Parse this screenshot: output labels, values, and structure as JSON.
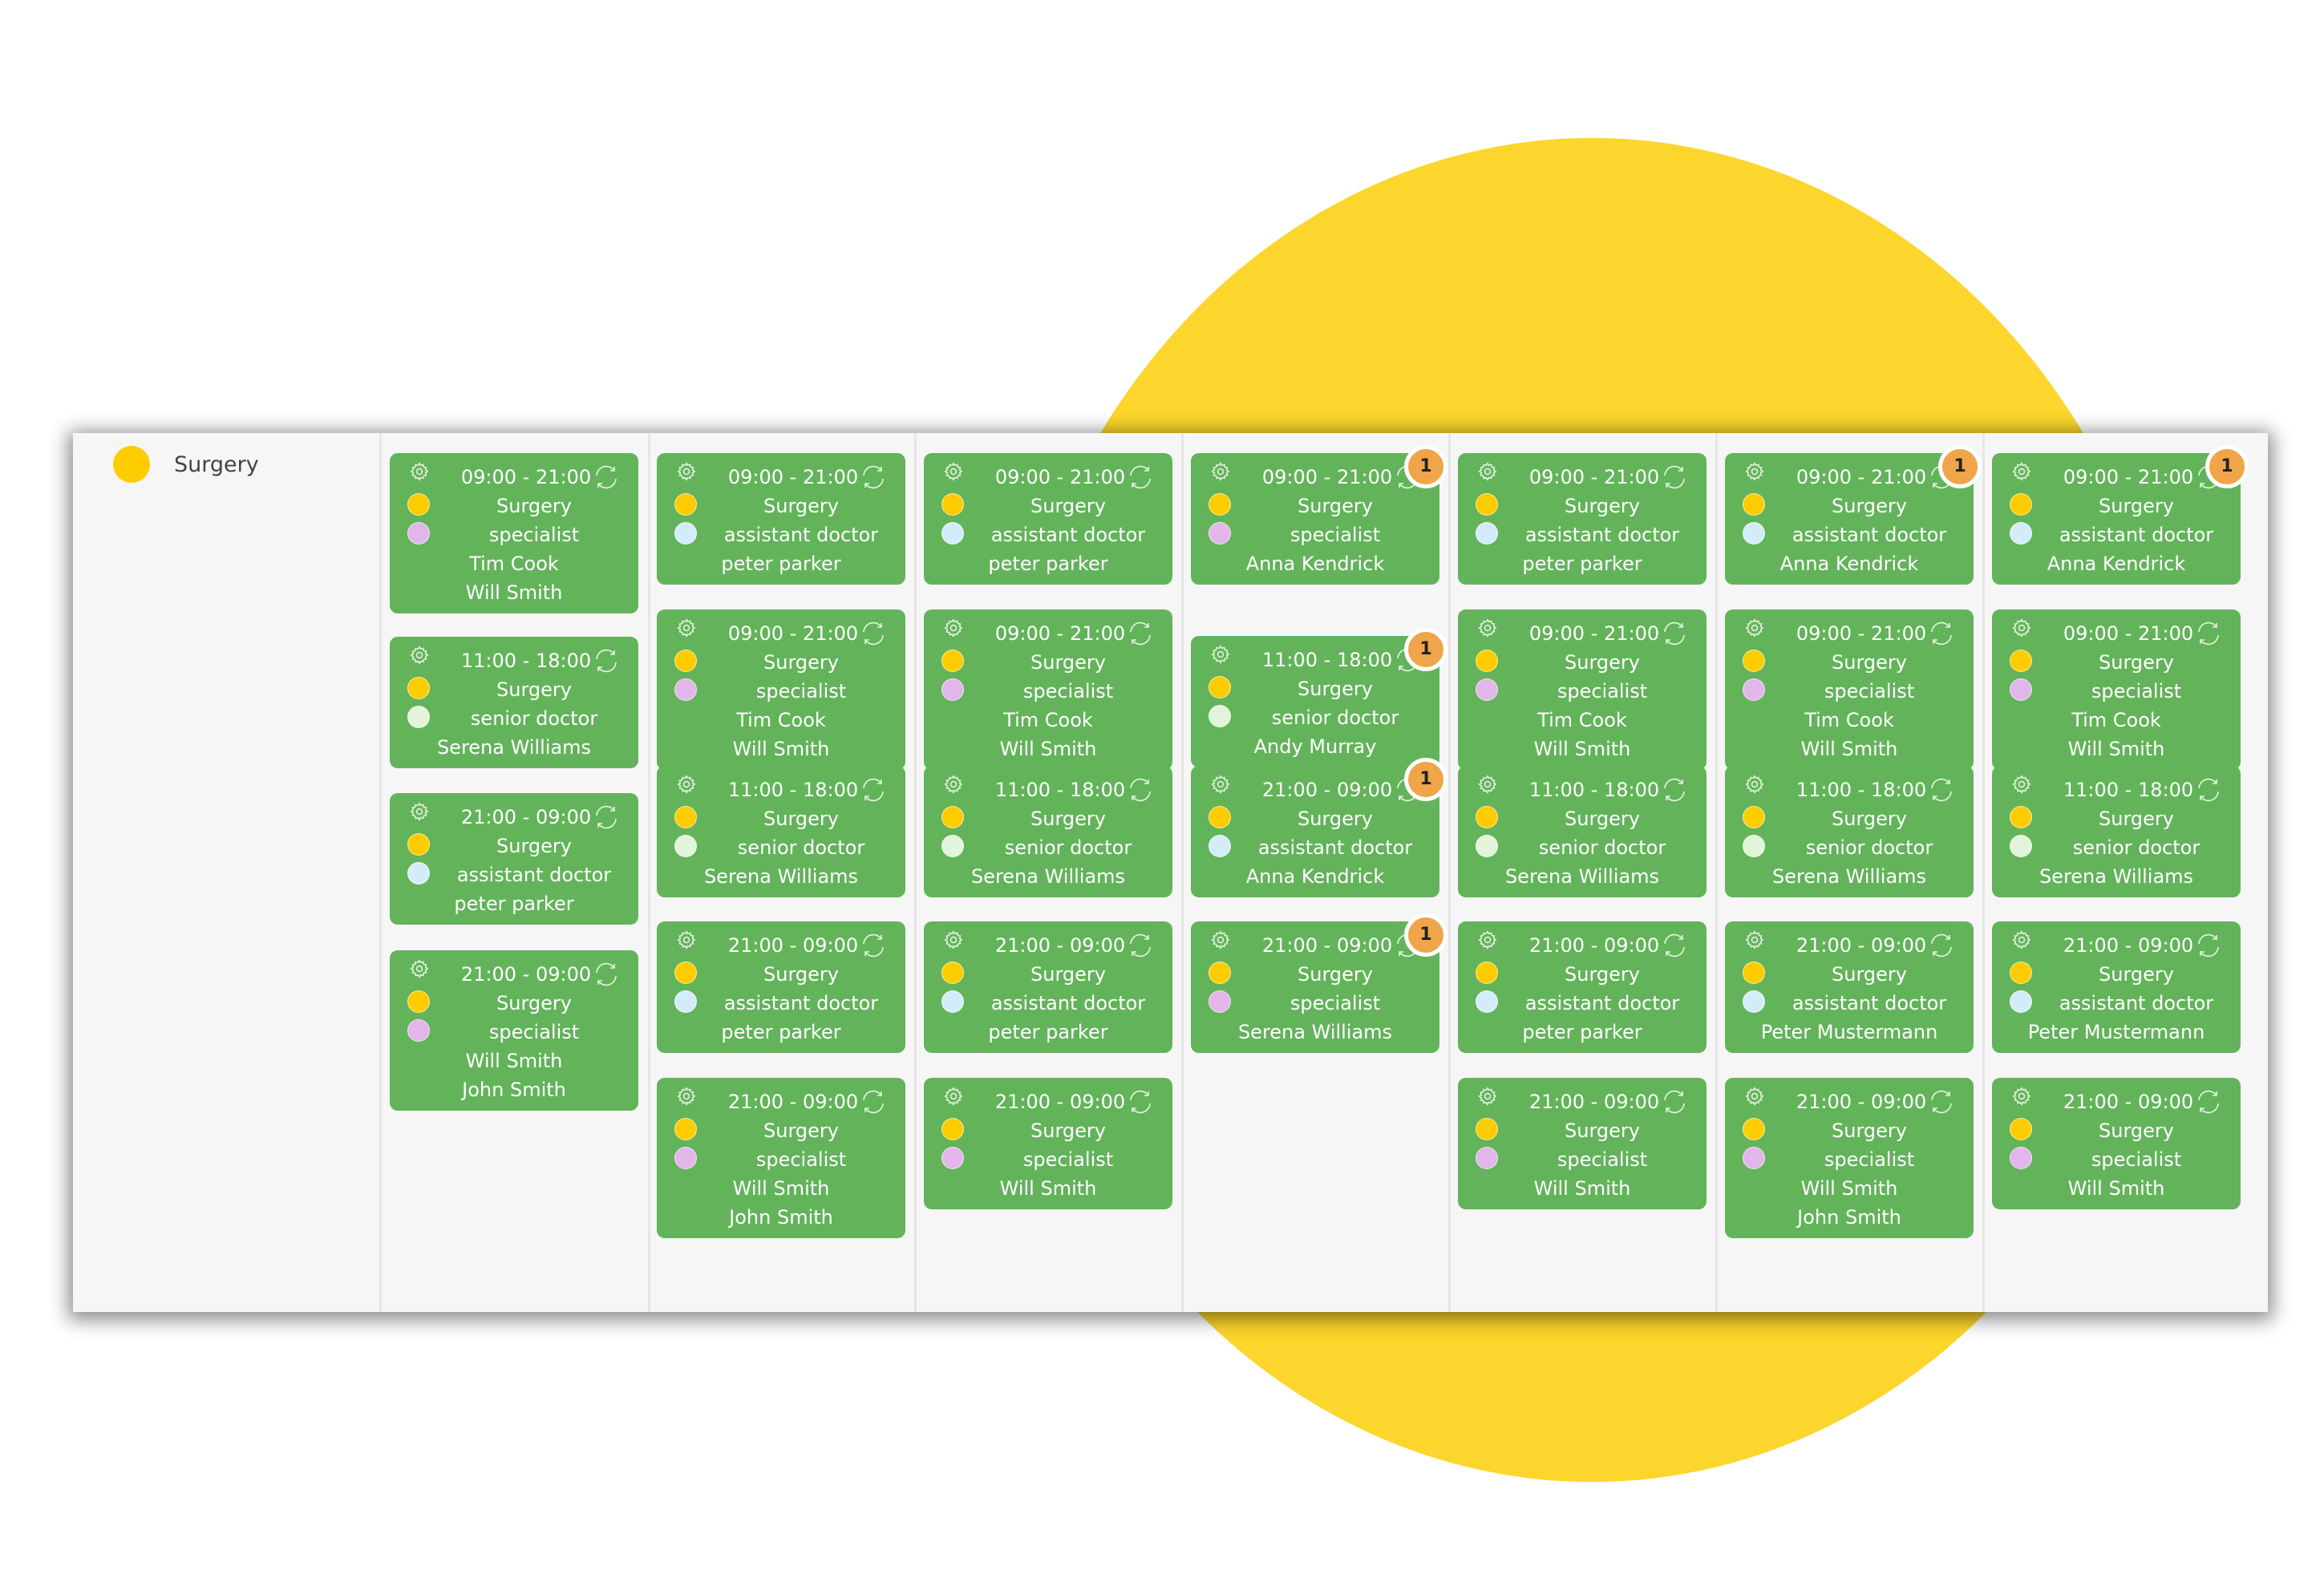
{
  "colors": {
    "card_bg": "#63b35b",
    "surgery_dot": "#ffcc00",
    "specialist_dot": "#e2b6ea",
    "assistant_dot": "#d4ecfa",
    "senior_dot": "#e2f5da",
    "badge": "#f0a54a",
    "accent_blob": "#fcd62c"
  },
  "legend": {
    "label": "Surgery",
    "color": "#ffcc00"
  },
  "columns": [
    {
      "cards": [
        {
          "time": "09:00 - 21:00",
          "dept": "Surgery",
          "role": "specialist",
          "people": [
            "Tim Cook",
            "Will Smith"
          ],
          "badge": null
        },
        {
          "time": "11:00 - 18:00",
          "dept": "Surgery",
          "role": "senior doctor",
          "people": [
            "Serena Williams"
          ],
          "badge": null
        },
        {
          "time": "21:00 - 09:00",
          "dept": "Surgery",
          "role": "assistant doctor",
          "people": [
            "peter parker"
          ],
          "badge": null
        },
        {
          "time": "21:00 - 09:00",
          "dept": "Surgery",
          "role": "specialist",
          "people": [
            "Will Smith",
            "John Smith"
          ],
          "badge": null
        }
      ]
    },
    {
      "cards": [
        {
          "time": "09:00 - 21:00",
          "dept": "Surgery",
          "role": "assistant doctor",
          "people": [
            "peter parker"
          ],
          "badge": null
        },
        {
          "time": "09:00 - 21:00",
          "dept": "Surgery",
          "role": "specialist",
          "people": [
            "Tim Cook",
            "Will Smith"
          ],
          "badge": null
        },
        {
          "time": "11:00 - 18:00",
          "dept": "Surgery",
          "role": "senior doctor",
          "people": [
            "Serena Williams"
          ],
          "badge": null
        },
        {
          "time": "21:00 - 09:00",
          "dept": "Surgery",
          "role": "assistant doctor",
          "people": [
            "peter parker"
          ],
          "badge": null
        },
        {
          "time": "21:00 - 09:00",
          "dept": "Surgery",
          "role": "specialist",
          "people": [
            "Will Smith",
            "John Smith"
          ],
          "badge": null
        }
      ]
    },
    {
      "cards": [
        {
          "time": "09:00 - 21:00",
          "dept": "Surgery",
          "role": "assistant doctor",
          "people": [
            "peter parker"
          ],
          "badge": null
        },
        {
          "time": "09:00 - 21:00",
          "dept": "Surgery",
          "role": "specialist",
          "people": [
            "Tim Cook",
            "Will Smith"
          ],
          "badge": null
        },
        {
          "time": "11:00 - 18:00",
          "dept": "Surgery",
          "role": "senior doctor",
          "people": [
            "Serena Williams"
          ],
          "badge": null
        },
        {
          "time": "21:00 - 09:00",
          "dept": "Surgery",
          "role": "assistant doctor",
          "people": [
            "peter parker"
          ],
          "badge": null
        },
        {
          "time": "21:00 - 09:00",
          "dept": "Surgery",
          "role": "specialist",
          "people": [
            "Will Smith"
          ],
          "badge": null
        }
      ]
    },
    {
      "cards": [
        {
          "time": "09:00 - 21:00",
          "dept": "Surgery",
          "role": "specialist",
          "people": [
            "Anna Kendrick"
          ],
          "badge": "1"
        },
        {
          "time": "11:00 - 18:00",
          "dept": "Surgery",
          "role": "senior doctor",
          "people": [
            "Andy Murray"
          ],
          "badge": "1"
        },
        {
          "time": "21:00 - 09:00",
          "dept": "Surgery",
          "role": "assistant doctor",
          "people": [
            "Anna Kendrick"
          ],
          "badge": "1"
        },
        {
          "time": "21:00 - 09:00",
          "dept": "Surgery",
          "role": "specialist",
          "people": [
            "Serena Williams"
          ],
          "badge": "1"
        }
      ]
    },
    {
      "cards": [
        {
          "time": "09:00 - 21:00",
          "dept": "Surgery",
          "role": "assistant doctor",
          "people": [
            "peter parker"
          ],
          "badge": null
        },
        {
          "time": "09:00 - 21:00",
          "dept": "Surgery",
          "role": "specialist",
          "people": [
            "Tim Cook",
            "Will Smith"
          ],
          "badge": null
        },
        {
          "time": "11:00 - 18:00",
          "dept": "Surgery",
          "role": "senior doctor",
          "people": [
            "Serena Williams"
          ],
          "badge": null
        },
        {
          "time": "21:00 - 09:00",
          "dept": "Surgery",
          "role": "assistant doctor",
          "people": [
            "peter parker"
          ],
          "badge": null
        },
        {
          "time": "21:00 - 09:00",
          "dept": "Surgery",
          "role": "specialist",
          "people": [
            "Will Smith"
          ],
          "badge": null
        }
      ]
    },
    {
      "cards": [
        {
          "time": "09:00 - 21:00",
          "dept": "Surgery",
          "role": "assistant doctor",
          "people": [
            "Anna Kendrick"
          ],
          "badge": "1"
        },
        {
          "time": "09:00 - 21:00",
          "dept": "Surgery",
          "role": "specialist",
          "people": [
            "Tim Cook",
            "Will Smith"
          ],
          "badge": null
        },
        {
          "time": "11:00 - 18:00",
          "dept": "Surgery",
          "role": "senior doctor",
          "people": [
            "Serena Williams"
          ],
          "badge": null
        },
        {
          "time": "21:00 - 09:00",
          "dept": "Surgery",
          "role": "assistant doctor",
          "people": [
            "Peter Mustermann"
          ],
          "badge": null
        },
        {
          "time": "21:00 - 09:00",
          "dept": "Surgery",
          "role": "specialist",
          "people": [
            "Will Smith",
            "John Smith"
          ],
          "badge": null
        }
      ]
    },
    {
      "cards": [
        {
          "time": "09:00 - 21:00",
          "dept": "Surgery",
          "role": "assistant doctor",
          "people": [
            "Anna Kendrick"
          ],
          "badge": "1"
        },
        {
          "time": "09:00 - 21:00",
          "dept": "Surgery",
          "role": "specialist",
          "people": [
            "Tim Cook",
            "Will Smith"
          ],
          "badge": null
        },
        {
          "time": "11:00 - 18:00",
          "dept": "Surgery",
          "role": "senior doctor",
          "people": [
            "Serena Williams"
          ],
          "badge": null
        },
        {
          "time": "21:00 - 09:00",
          "dept": "Surgery",
          "role": "assistant doctor",
          "people": [
            "Peter Mustermann"
          ],
          "badge": null
        },
        {
          "time": "21:00 - 09:00",
          "dept": "Surgery",
          "role": "specialist",
          "people": [
            "Will Smith"
          ],
          "badge": null
        }
      ]
    }
  ]
}
